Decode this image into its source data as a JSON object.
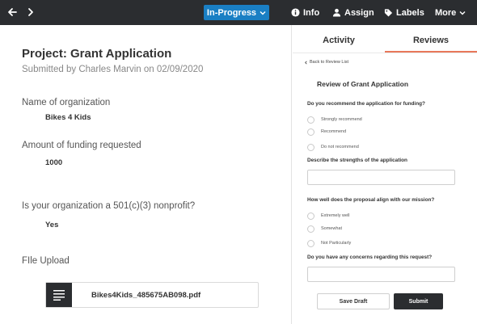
{
  "topbar": {
    "status_label": "In-Progress",
    "actions": {
      "info": "Info",
      "assign": "Assign",
      "labels": "Labels",
      "more": "More"
    }
  },
  "project": {
    "title": "Project: Grant Application",
    "subtitle": "Submitted by Charles Marvin on 02/09/2020"
  },
  "fields": {
    "org_name_label": "Name of organization",
    "org_name_value": "Bikes 4 Kids",
    "funding_label": "Amount of funding requested",
    "funding_value": "1000",
    "nonprofit_label": "Is your organization a 501(c)(3) nonprofit?",
    "nonprofit_value": "Yes",
    "file_label": "FIle Upload",
    "file_name": "Bikes4Kids_485675AB098.pdf"
  },
  "tabs": {
    "activity": "Activity",
    "reviews": "Reviews"
  },
  "review": {
    "back_link": "Back to Review List",
    "title": "Review of Grant Application",
    "q1": "Do you recommend the application for funding?",
    "q1_options": [
      "Strongly recommend",
      "Recommend",
      "Do not recommend"
    ],
    "q2": "Describe the strengths of the application",
    "q3": "How well does the proposal align with our mission?",
    "q3_options": [
      "Extremely well",
      "Somewhat",
      "Not Particularly"
    ],
    "q4": "Do you have any concerns regarding this request?",
    "save_draft": "Save Draft",
    "submit": "Submit"
  },
  "colors": {
    "topbar": "#2b2d30",
    "status": "#1a7fc4",
    "active_tab_underline": "#e8785a",
    "inactive_tab_underline": "#e8e8e8"
  }
}
